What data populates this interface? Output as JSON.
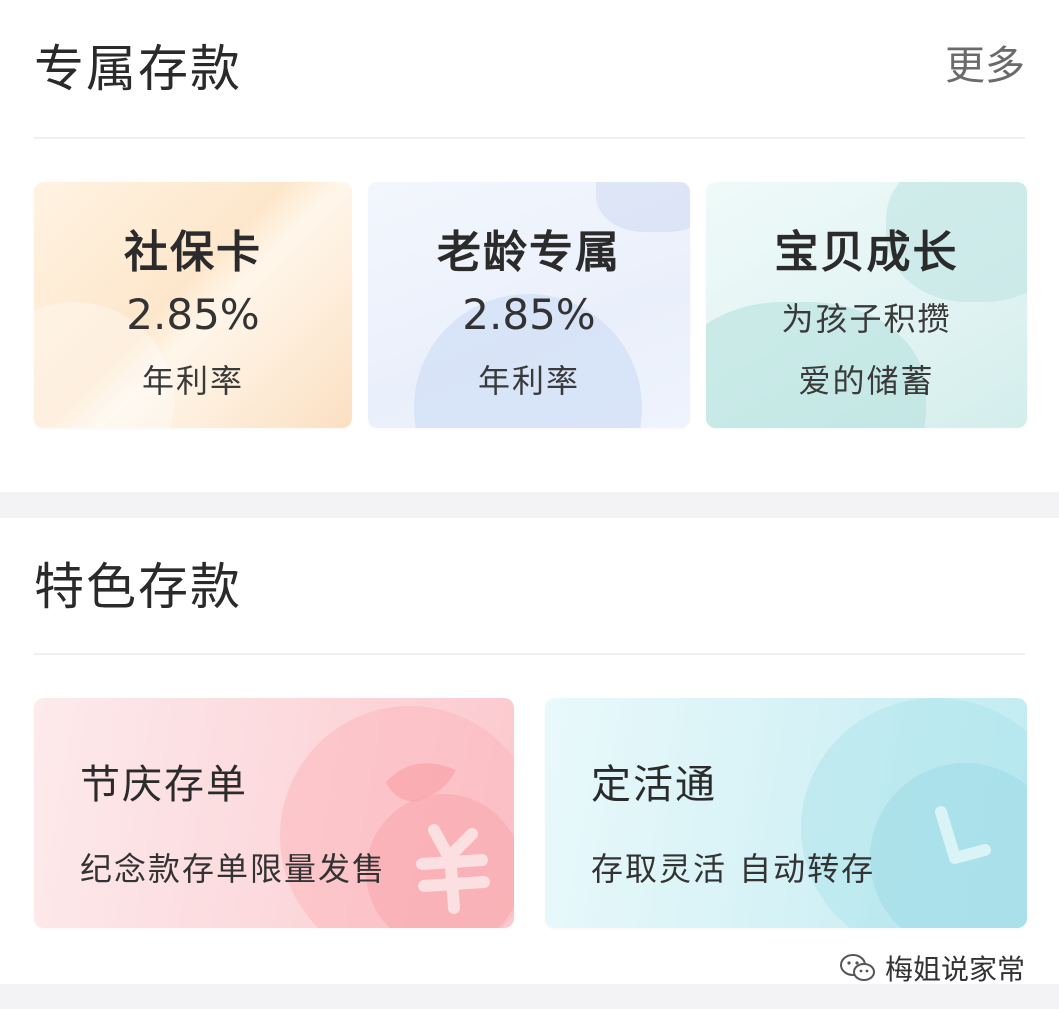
{
  "exclusive": {
    "title": "专属存款",
    "more": "更多",
    "cards": [
      {
        "title": "社保卡",
        "rate": "2.85%",
        "rate_label": "年利率"
      },
      {
        "title": "老龄专属",
        "rate": "2.85%",
        "rate_label": "年利率"
      },
      {
        "title": "宝贝成长",
        "line1": "为孩子积攒",
        "line2": "爱的储蓄"
      }
    ]
  },
  "featured": {
    "title": "特色存款",
    "cards": [
      {
        "title": "节庆存单",
        "subtitle": "纪念款存单限量发售",
        "icon": "money-bag-icon"
      },
      {
        "title": "定活通",
        "subtitle": "存取灵活 自动转存",
        "icon": "clock-icon"
      }
    ]
  },
  "watermark": {
    "text": "梅姐说家常",
    "icon": "wechat-icon"
  },
  "colors": {
    "page_bg": "#f3f3f5",
    "card_orange": "#fde7cc",
    "card_blue": "#eaf0fb",
    "card_teal": "#d3eeec",
    "card_pink": "#fbc8cd",
    "card_cyan": "#c0ebf2"
  }
}
